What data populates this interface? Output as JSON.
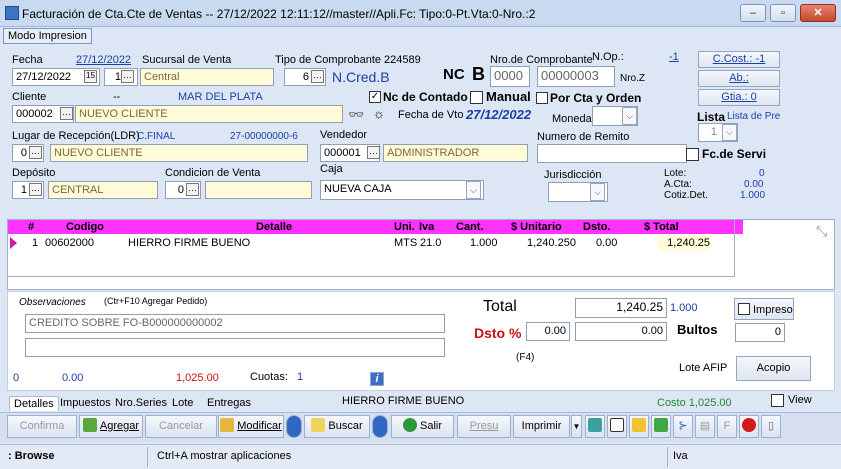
{
  "window": {
    "title": "Facturación de Cta.Cte de Ventas -- 27/12/2022 12:11:12//master//Apli.Fc: Tipo:0-Pt.Vta:0-Nro.:2",
    "btn_min": "–",
    "btn_max": "▫",
    "btn_close": "✕"
  },
  "menu": {
    "modo_impresion": "Modo Impresion"
  },
  "header": {
    "fecha_label": "Fecha",
    "fecha_link": "27/12/2022",
    "fecha_value": "27/12/2022",
    "cal_icon": "15",
    "sucursal_label": "Sucursal de Venta",
    "sucursal_code": "1",
    "sucursal_name": "Central",
    "tipo_comp_label": "Tipo de Comprobante 224589",
    "tipo_comp_code": "6",
    "tipo_comp_name": "N.Cred.B",
    "nro_comp_label": "Nro.de Comprobante",
    "nop_label": "N.Op.:",
    "nc_label": "NC",
    "letter": "B",
    "pv": "0000",
    "numero": "00000003",
    "nroz": "Nro.Z",
    "minus1": "-1",
    "ccost": "C.Cost.: -1",
    "ab": "Ab.:",
    "gtia": "Gtia.: 0",
    "cliente_label": "Cliente",
    "cliente_dash": "--",
    "cliente_city": "MAR DEL PLATA",
    "cliente_code": "000002",
    "cliente_name": "NUEVO CLIENTE",
    "nc_contado": "Nc de Contado",
    "manual": "Manual",
    "por_cta": "Por Cta y Orden",
    "fecha_vto_label": "Fecha de Vto",
    "fecha_vto": "27/12/2022",
    "moneda_label": "Moneda",
    "lista_label": "Lista",
    "lista_prec": "Lista de Pre",
    "lista_value": "1",
    "lugar_label": "Lugar de Recepción(LDR)",
    "lugar_tipo": "C.FINAL",
    "lugar_cuit": "27-00000000-6",
    "lugar_code": "0",
    "lugar_name": "NUEVO CLIENTE",
    "vendedor_label": "Vendedor",
    "vendedor_code": "000001",
    "vendedor_name": "ADMINISTRADOR",
    "remito_label": "Numero de Remito",
    "fc_servi": "Fc.de Servi",
    "deposito_label": "Depósito",
    "deposito_code": "1",
    "deposito_name": "CENTRAL",
    "cond_label": "Condicion de Venta",
    "cond_code": "0",
    "caja_label": "Caja",
    "caja_value": "NUEVA CAJA",
    "juris_label": "Jurisdicción",
    "lote_label": "Lote:",
    "lote_value": "0",
    "acta_label": "A.Cta:",
    "acta_value": "0.00",
    "cotiz_label": "Cotiz.Det.",
    "cotiz_value": "1.000"
  },
  "grid": {
    "headers": [
      "#",
      "Codigo",
      "Detalle",
      "Uni.",
      "Iva",
      "Cant.",
      "$ Unitario",
      "Dsto.",
      "$ Total"
    ],
    "rows": [
      [
        "1",
        "00602000",
        "HIERRO FIRME BUENO",
        "MTS",
        "21.0",
        "1.000",
        "1,240.250",
        "0.00",
        "1,240.25"
      ]
    ]
  },
  "obs": {
    "label": "Observaciones",
    "hint": "(Ctr+F10 Agregar Pedido)",
    "text1": "CREDITO SOBRE FO-B000000000002",
    "text2": ""
  },
  "totals": {
    "total_label": "Total",
    "total_value": "1,240.25",
    "cotiz": "1.000",
    "impreso": "Impreso",
    "dsto_label": "Dsto %",
    "dsto_pct": "0.00",
    "dsto_value": "0.00",
    "bultos_label": "Bultos",
    "bultos_value": "0",
    "f4": "(F4)",
    "lote_afip": "Lote AFIP",
    "acopio": "Acopio"
  },
  "bottom": {
    "n0": "0",
    "n1": "0.00",
    "n2": "1,025.00",
    "cuotas_label": "Cuotas:",
    "cuotas_value": "1",
    "info_icon": "i"
  },
  "tabs": [
    "Detalles",
    "Impuestos",
    "Nro.Series",
    "Lote",
    "Entregas"
  ],
  "bottom_item": "HIERRO FIRME BUENO",
  "costo": "Costo 1,025.00",
  "view": "View",
  "toolbar": {
    "confirma": "Confirma",
    "agregar": "Agregar",
    "cancelar": "Cancelar",
    "modificar": "Modificar",
    "buscar": "Buscar",
    "salir": "Salir",
    "presu": "Presu",
    "imprimir": "Imprimir"
  },
  "status": {
    "mode": ": Browse",
    "hint": "Ctrl+A mostrar aplicaciones",
    "right": "Iva"
  },
  "colors": {
    "grid_header": "#ff33ff",
    "accent_blue": "#1b3fa8",
    "danger": "#cc1111"
  }
}
